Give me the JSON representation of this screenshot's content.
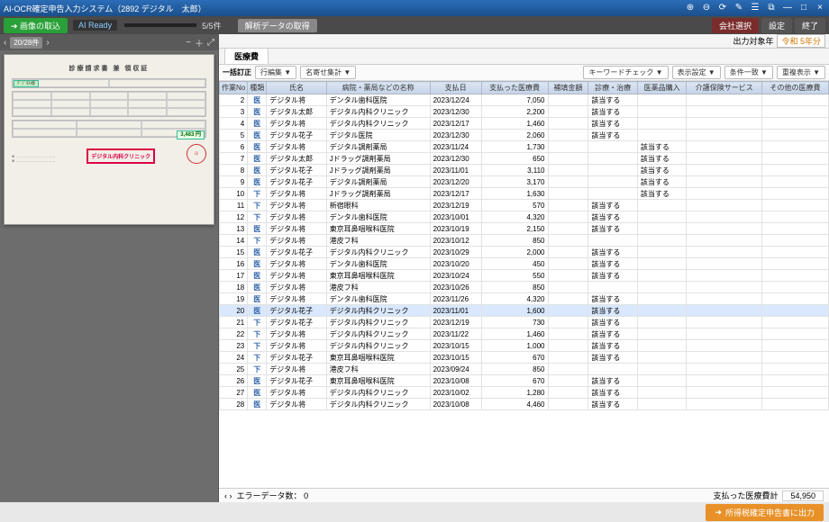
{
  "titlebar": {
    "title": "AI-OCR確定申告入力システム（2892 デジタル　太郎）"
  },
  "toolbar": {
    "import_btn": "➔ 画像の取込",
    "ai_ready": "AI Ready",
    "progress_text": "5/5件",
    "parse_btn": "解析データの取得",
    "co_select": "会社選択",
    "settings": "設定",
    "close": "終了"
  },
  "left": {
    "page_pill": "20/28件",
    "doc_title": "診療請求書 兼 領収証",
    "clinic_name": "デジタル内科クリニック",
    "amount_label": "3,483 円"
  },
  "rightbar": {
    "period_label": "出力対象年",
    "period_value": "令和 5年分"
  },
  "tabs": {
    "main": "医療費"
  },
  "subtool": {
    "mode": "一括訂正",
    "dd1": "行編集 ▼",
    "dd2": "名寄せ集計 ▼",
    "kw": "キーワードチェック ▼",
    "disp": "表示設定 ▼",
    "cond": "条件一致 ▼",
    "hide": "重複表示 ▼"
  },
  "columns": {
    "idx": "作業No",
    "kind": "種類",
    "name": "氏名",
    "inst": "病院・薬局などの名称",
    "date": "支払日",
    "paid": "支払った医療費",
    "comp": "補填金額",
    "c1": "診療・治療",
    "c2": "医薬品購入",
    "c3": "介護保険サービス",
    "c4": "その他の医療費"
  },
  "rows": [
    {
      "i": 2,
      "k": "医",
      "n": "デジタル将",
      "h": "デンタル歯科医院",
      "d": "2023/12/24",
      "p": "7,050",
      "c1": "該当する"
    },
    {
      "i": 3,
      "k": "医",
      "n": "デジタル太郎",
      "h": "デジタル内科クリニック",
      "d": "2023/12/30",
      "p": "2,200",
      "c1": "該当する"
    },
    {
      "i": 4,
      "k": "医",
      "n": "デジタル将",
      "h": "デジタル内科クリニック",
      "d": "2023/12/17",
      "p": "1,460",
      "c1": "該当する"
    },
    {
      "i": 5,
      "k": "医",
      "n": "デジタル花子",
      "h": "デジタル医院",
      "d": "2023/12/30",
      "p": "2,060",
      "c1": "該当する"
    },
    {
      "i": 6,
      "k": "医",
      "n": "デジタル将",
      "h": "デジタル調剤薬局",
      "d": "2023/11/24",
      "p": "1,730",
      "c2": "該当する"
    },
    {
      "i": 7,
      "k": "医",
      "n": "デジタル太郎",
      "h": "Jドラッグ調剤薬局",
      "d": "2023/12/30",
      "p": "650",
      "c2": "該当する"
    },
    {
      "i": 8,
      "k": "医",
      "n": "デジタル花子",
      "h": "Jドラッグ調剤薬局",
      "d": "2023/11/01",
      "p": "3,110",
      "c2": "該当する"
    },
    {
      "i": 9,
      "k": "医",
      "n": "デジタル花子",
      "h": "デジタル調剤薬局",
      "d": "2023/12/20",
      "p": "3,170",
      "c2": "該当する"
    },
    {
      "i": 10,
      "k": "下",
      "n": "デジタル将",
      "h": "Jドラッグ調剤薬局",
      "d": "2023/12/17",
      "p": "1,630",
      "c2": "該当する"
    },
    {
      "i": 11,
      "k": "下",
      "n": "デジタル将",
      "h": "新宿眼科",
      "d": "2023/12/19",
      "p": "570",
      "c1": "該当する"
    },
    {
      "i": 12,
      "k": "下",
      "n": "デジタル将",
      "h": "デンタル歯科医院",
      "d": "2023/10/01",
      "p": "4,320",
      "c1": "該当する"
    },
    {
      "i": 13,
      "k": "医",
      "n": "デジタル将",
      "h": "東京耳鼻咽喉科医院",
      "d": "2023/10/19",
      "p": "2,150",
      "c1": "該当する"
    },
    {
      "i": 14,
      "k": "下",
      "n": "デジタル将",
      "h": "港皮フ科",
      "d": "2023/10/12",
      "p": "850"
    },
    {
      "i": 15,
      "k": "医",
      "n": "デジタル花子",
      "h": "デジタル内科クリニック",
      "d": "2023/10/29",
      "p": "2,000",
      "c1": "該当する"
    },
    {
      "i": 16,
      "k": "医",
      "n": "デジタル将",
      "h": "デンタル歯科医院",
      "d": "2023/10/20",
      "p": "450",
      "c1": "該当する"
    },
    {
      "i": 17,
      "k": "医",
      "n": "デジタル将",
      "h": "東京耳鼻咽喉科医院",
      "d": "2023/10/24",
      "p": "550",
      "c1": "該当する"
    },
    {
      "i": 18,
      "k": "医",
      "n": "デジタル将",
      "h": "港皮フ科",
      "d": "2023/10/26",
      "p": "850"
    },
    {
      "i": 19,
      "k": "医",
      "n": "デジタル将",
      "h": "デンタル歯科医院",
      "d": "2023/11/26",
      "p": "4,320",
      "c1": "該当する"
    },
    {
      "i": 20,
      "k": "医",
      "n": "デジタル花子",
      "h": "デジタル内科クリニック",
      "d": "2023/11/01",
      "p": "1,600",
      "c1": "該当する",
      "sel": true
    },
    {
      "i": 21,
      "k": "下",
      "n": "デジタル花子",
      "h": "デジタル内科クリニック",
      "d": "2023/12/19",
      "p": "730",
      "c1": "該当する"
    },
    {
      "i": 22,
      "k": "下",
      "n": "デジタル将",
      "h": "デジタル内科クリニック",
      "d": "2023/11/22",
      "p": "1,460",
      "c1": "該当する"
    },
    {
      "i": 23,
      "k": "下",
      "n": "デジタル将",
      "h": "デジタル内科クリニック",
      "d": "2023/10/15",
      "p": "1,000",
      "c1": "該当する"
    },
    {
      "i": 24,
      "k": "下",
      "n": "デジタル花子",
      "h": "東京耳鼻咽喉科医院",
      "d": "2023/10/15",
      "p": "670",
      "c1": "該当する"
    },
    {
      "i": 25,
      "k": "下",
      "n": "デジタル将",
      "h": "港皮フ科",
      "d": "2023/09/24",
      "p": "850"
    },
    {
      "i": 26,
      "k": "医",
      "n": "デジタル花子",
      "h": "東京耳鼻咽喉科医院",
      "d": "2023/10/08",
      "p": "670",
      "c1": "該当する"
    },
    {
      "i": 27,
      "k": "医",
      "n": "デジタル将",
      "h": "デジタル内科クリニック",
      "d": "2023/10/02",
      "p": "1,280",
      "c1": "該当する"
    },
    {
      "i": 28,
      "k": "医",
      "n": "デジタル将",
      "h": "デジタル内科クリニック",
      "d": "2023/10/08",
      "p": "4,460",
      "c1": "該当する"
    }
  ],
  "footer": {
    "err_label": "エラーデータ数：",
    "err_count": "0",
    "sum_label": "支払った医療費計",
    "sum_value": "54,950",
    "export_btn": "所得税確定申告書に出力"
  }
}
